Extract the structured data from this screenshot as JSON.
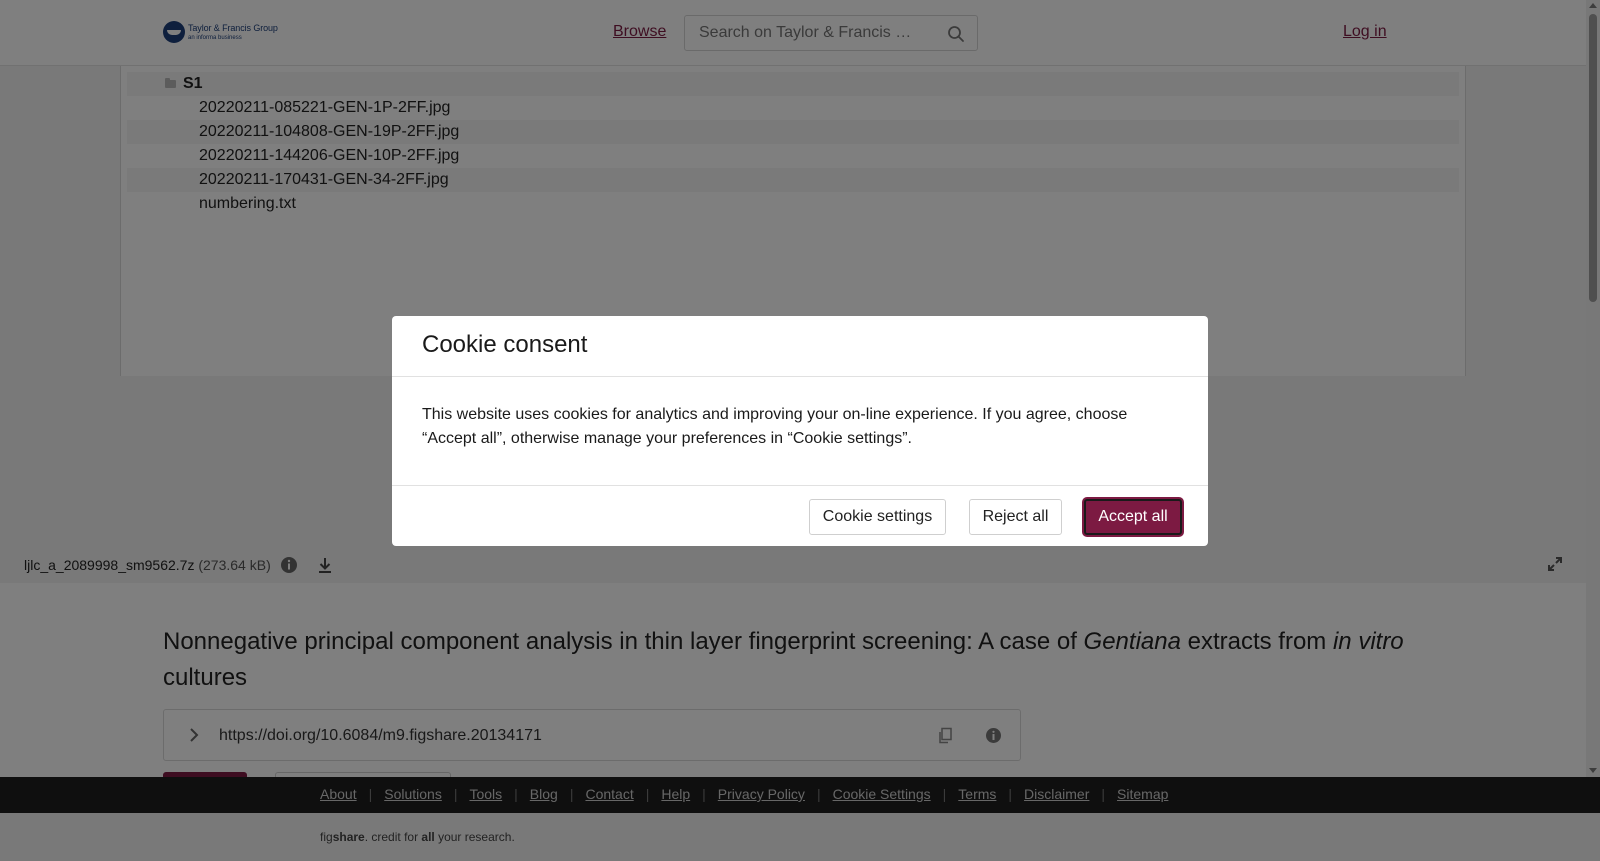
{
  "header": {
    "logo_main": "Taylor & Francis Group",
    "logo_sub": "an informa business",
    "browse_label": "Browse",
    "search_placeholder": "Search on Taylor & Francis …",
    "login_label": "Log in"
  },
  "file_tree": {
    "folder": "S1",
    "files": [
      "20220211-085221-GEN-1P-2FF.jpg",
      "20220211-104808-GEN-19P-2FF.jpg",
      "20220211-144206-GEN-10P-2FF.jpg",
      "20220211-170431-GEN-34-2FF.jpg",
      "numbering.txt"
    ]
  },
  "file_info": {
    "name": "ljlc_a_2089998_sm9562.7z",
    "size": "(273.64 kB)"
  },
  "article": {
    "title_part1": "Nonnegative principal component analysis in thin layer fingerprint screening: A case of ",
    "title_italic1": "Gentiana",
    "title_part2": " extracts from ",
    "title_italic2": "in vitro",
    "title_part3": " cultures",
    "doi": "https://doi.org/10.6084/m9.figshare.20134171"
  },
  "footer": {
    "links": [
      "About",
      "Solutions",
      "Tools",
      "Blog",
      "Contact",
      "Help",
      "Privacy Policy",
      "Cookie Settings",
      "Terms",
      "Disclaimer",
      "Sitemap"
    ],
    "tagline_prefix": "fig",
    "tagline_bold1": "share",
    "tagline_mid": ". credit for ",
    "tagline_bold2": "all",
    "tagline_suffix": " your research."
  },
  "cookie_modal": {
    "title": "Cookie consent",
    "body": "This website uses cookies for analytics and improving your on-line experience. If you agree, choose “Accept all”, otherwise manage your preferences in “Cookie settings”.",
    "settings_label": "Cookie settings",
    "reject_label": "Reject all",
    "accept_label": "Accept all"
  },
  "colors": {
    "brand": "#7c1a42",
    "footer_bg": "#1f1f1f"
  }
}
